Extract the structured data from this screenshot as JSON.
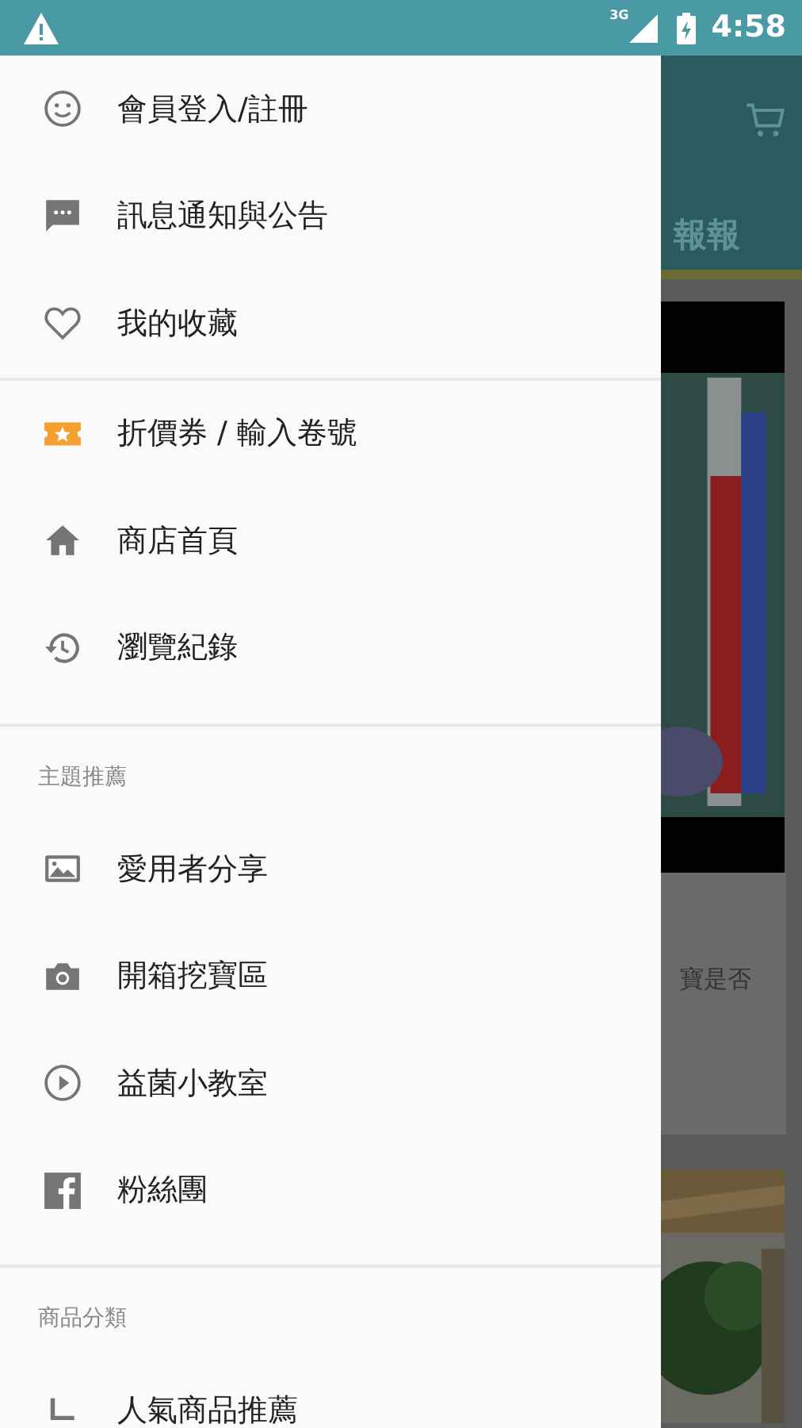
{
  "status_bar": {
    "network": "3G",
    "time": "4:58"
  },
  "background_app": {
    "tab_text": "報報",
    "card_text": "寶是否"
  },
  "drawer": {
    "sections": [
      {
        "items": [
          {
            "label": "會員登入/註冊"
          },
          {
            "label": "訊息通知與公告"
          },
          {
            "label": "我的收藏"
          }
        ]
      },
      {
        "items": [
          {
            "label": "折價券 / 輸入卷號"
          },
          {
            "label": "商店首頁"
          },
          {
            "label": "瀏覽紀錄"
          }
        ]
      },
      {
        "header": "主題推薦",
        "items": [
          {
            "label": "愛用者分享"
          },
          {
            "label": "開箱挖寶區"
          },
          {
            "label": "益菌小教室"
          },
          {
            "label": "粉絲團"
          }
        ]
      },
      {
        "header": "商品分類",
        "items": [
          {
            "label": "人氣商品推薦"
          }
        ]
      }
    ]
  }
}
